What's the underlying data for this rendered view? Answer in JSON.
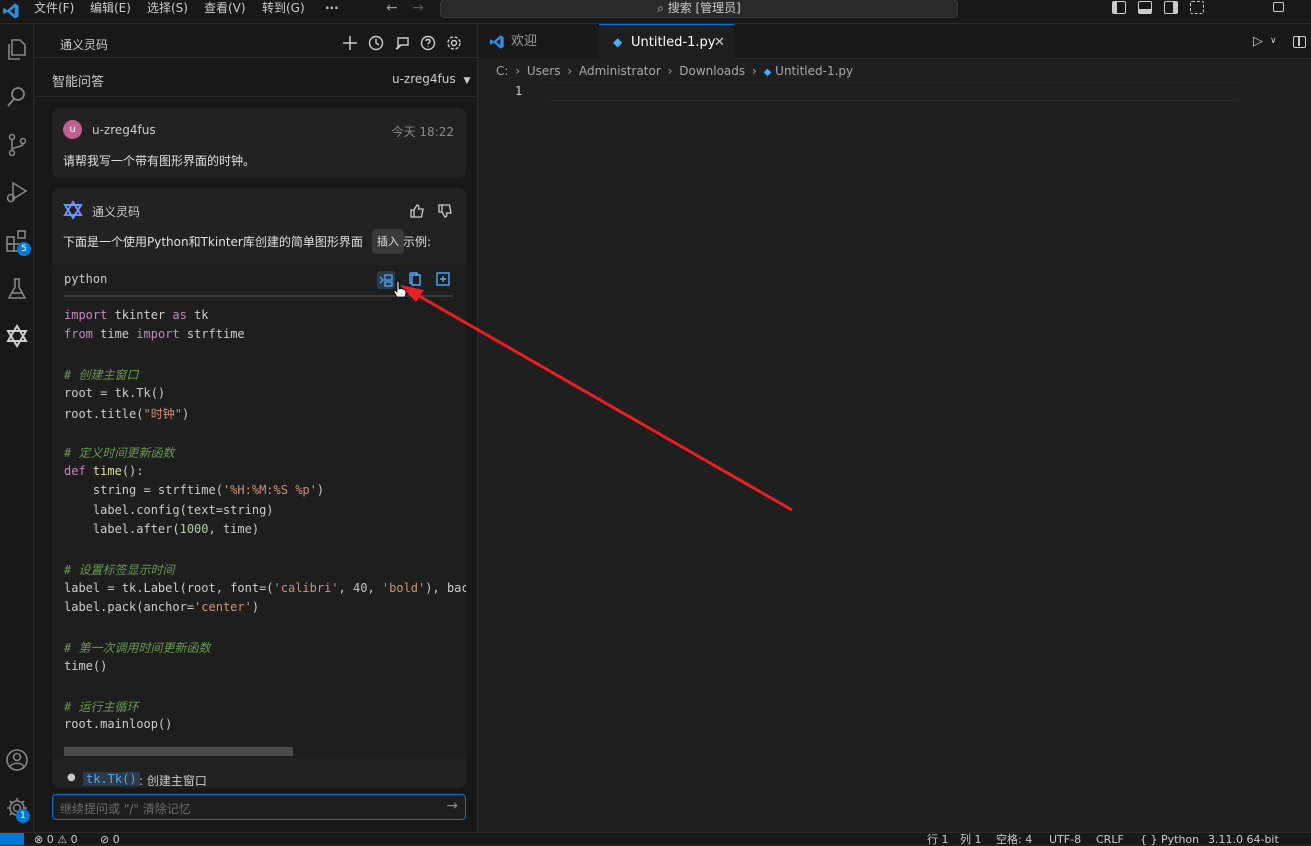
{
  "titlebar": {
    "menus": [
      "文件(F)",
      "编辑(E)",
      "选择(S)",
      "查看(V)",
      "转到(G)"
    ],
    "more": "···",
    "search": "搜索 [管理员]"
  },
  "activitybar": {
    "extensions_badge": "5",
    "settings_badge": "1"
  },
  "sidepanel": {
    "title": "通义灵码",
    "subtitle": "智能问答",
    "user_select": "u-zreg4fus",
    "user_message": {
      "avatar": "u",
      "name": "u-zreg4fus",
      "time": "今天 18:22",
      "text": "请帮我写一个带有图形界面的时钟。"
    },
    "assistant_message": {
      "name": "通义灵码",
      "intro_a": "下面是一个使用Python和Tkinter库创建的简单图形界面",
      "intro_b": "示例:",
      "tooltip": "插入",
      "code_lang": "python",
      "bullet_code": "tk.Tk()",
      "bullet_text": ": 创建主窗口"
    },
    "input_placeholder": "继续提问或 \"/\" 清除记忆"
  },
  "editor": {
    "tabs": [
      {
        "label": "欢迎"
      },
      {
        "label": "Untitled-1.py"
      }
    ],
    "breadcrumb": [
      "C:",
      "Users",
      "Administrator",
      "Downloads",
      "Untitled-1.py"
    ],
    "line_number": "1"
  },
  "statusbar": {
    "problems": "⊗ 0 ⚠ 0",
    "ports": "⊘ 0",
    "items": [
      "行 1",
      "列 1",
      "空格: 4",
      "UTF-8",
      "CRLF",
      "{ } Python",
      "3.11.0 64-bit"
    ]
  },
  "colors": {
    "accent": "#0078d4",
    "annotation_arrow": "#e81f25"
  }
}
